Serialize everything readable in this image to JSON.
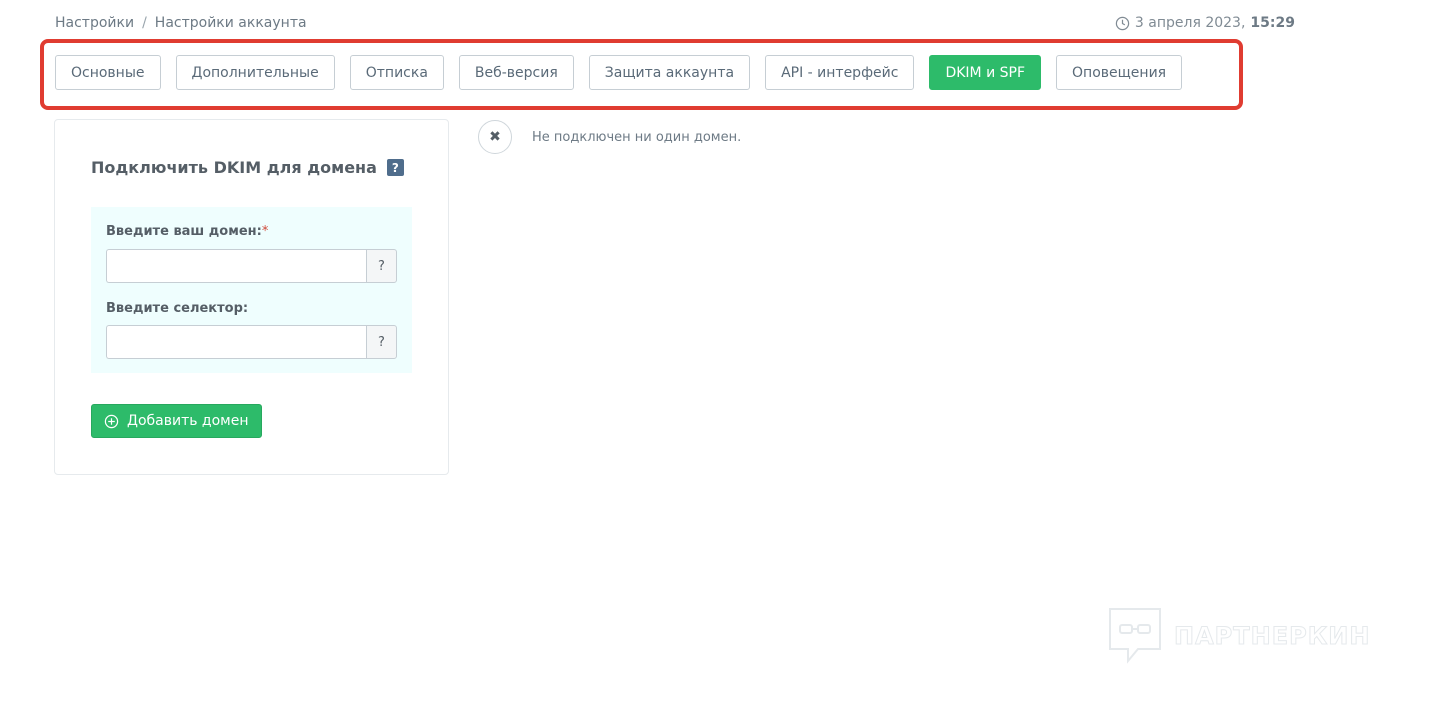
{
  "breadcrumb": {
    "items": [
      "Настройки",
      "Настройки аккаунта"
    ],
    "separator": "/"
  },
  "datetime": {
    "date": "3 апреля 2023,",
    "time": "15:29"
  },
  "tabs": [
    {
      "label": "Основные"
    },
    {
      "label": "Дополнительные"
    },
    {
      "label": "Отписка"
    },
    {
      "label": "Веб-версия"
    },
    {
      "label": "Защита аккаунта"
    },
    {
      "label": "API - интерфейс"
    },
    {
      "label": "DKIM и SPF",
      "active": true
    },
    {
      "label": "Оповещения"
    }
  ],
  "card": {
    "title": "Подключить DKIM для домена",
    "help": "?",
    "domain_label": "Введите ваш домен:",
    "required_mark": "*",
    "domain_value": "",
    "domain_help": "?",
    "selector_label": "Введите селектор:",
    "selector_value": "",
    "selector_help": "?",
    "add_button": "Добавить домен"
  },
  "status": {
    "icon": "close-icon",
    "text": "Не подключен ни один домен."
  },
  "watermark": {
    "text": "ПАРТНЕРКИН"
  },
  "colors": {
    "accent": "#2dbb6a",
    "highlight_frame": "#e03c31",
    "help_badge": "#4f6d8c",
    "form_bg": "#effefe"
  }
}
